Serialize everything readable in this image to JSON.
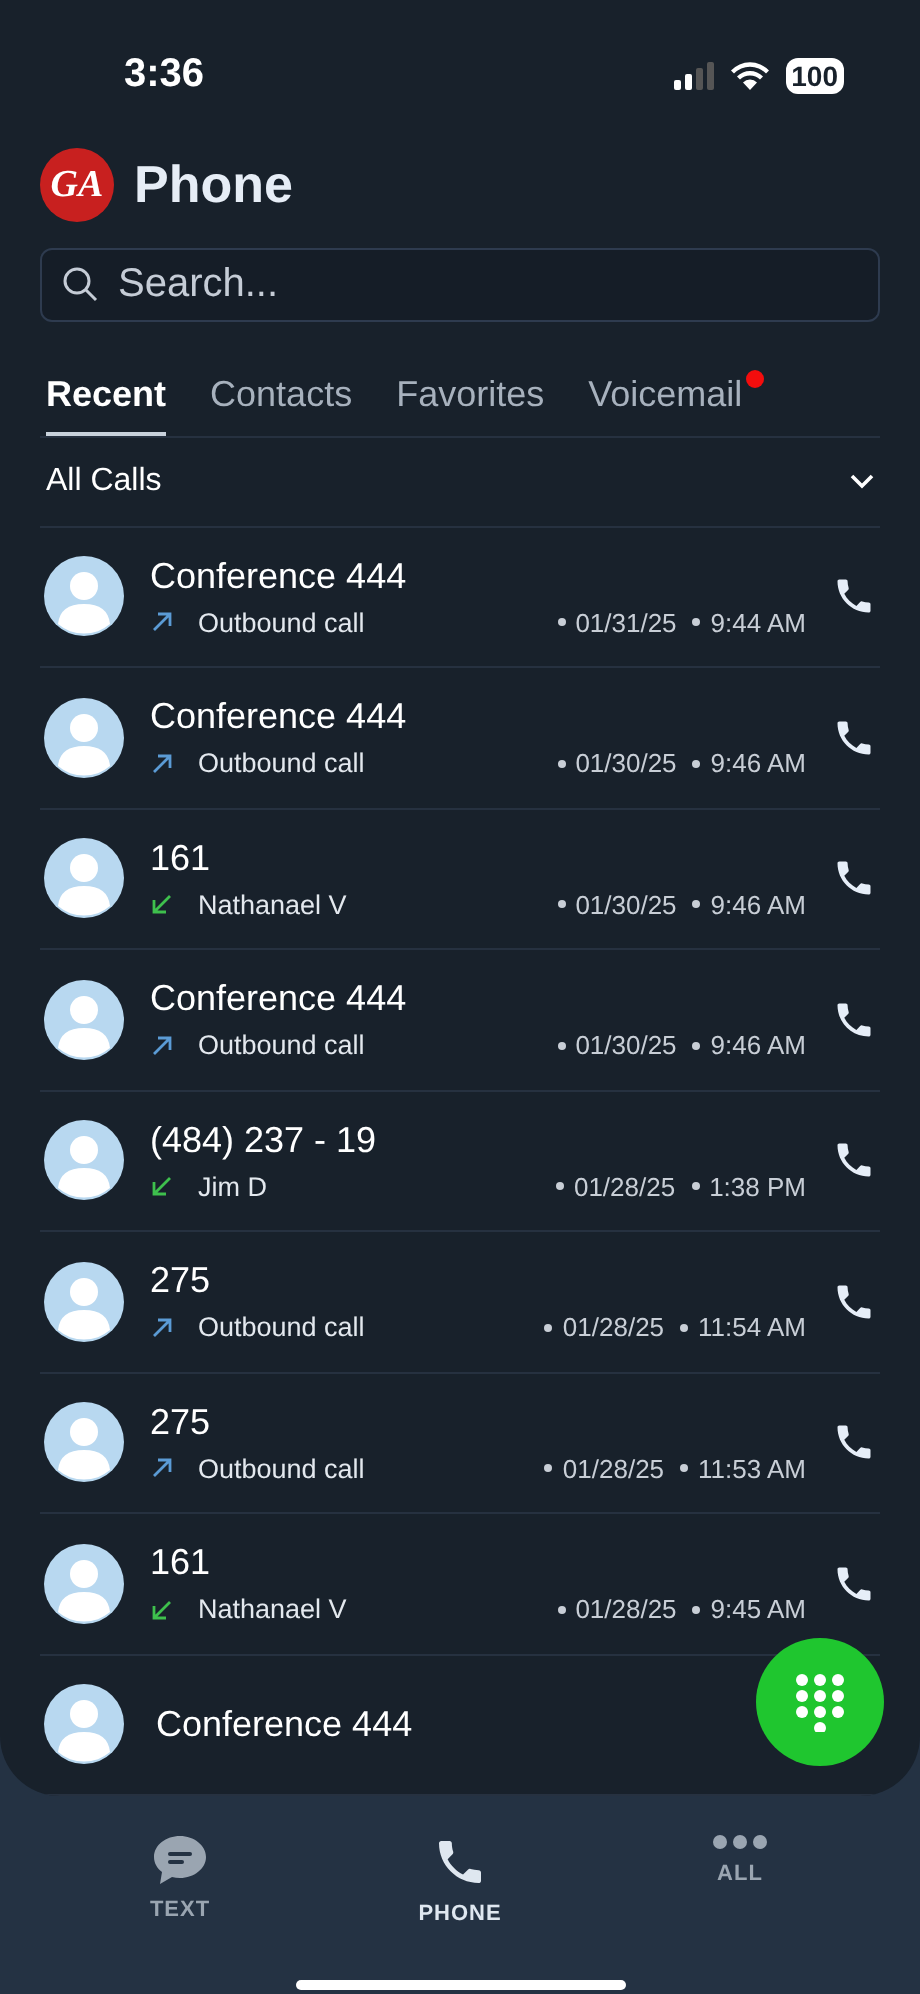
{
  "status_bar": {
    "time": "3:36",
    "battery": "100"
  },
  "header": {
    "logo": "GA",
    "title": "Phone"
  },
  "search": {
    "placeholder": "Search..."
  },
  "tabs": [
    {
      "label": "Recent",
      "selected": true,
      "badge": false
    },
    {
      "label": "Contacts",
      "selected": false,
      "badge": false
    },
    {
      "label": "Favorites",
      "selected": false,
      "badge": false
    },
    {
      "label": "Voicemail",
      "selected": false,
      "badge": true
    }
  ],
  "filter": {
    "label": "All Calls"
  },
  "calls": [
    {
      "name": "Conference 444",
      "kind": "outbound",
      "detail": "Outbound call",
      "date": "01/31/25",
      "time": "9:44 AM"
    },
    {
      "name": "Conference 444",
      "kind": "outbound",
      "detail": "Outbound call",
      "date": "01/30/25",
      "time": "9:46 AM"
    },
    {
      "name": "161",
      "kind": "inbound",
      "detail": "Nathanael V",
      "date": "01/30/25",
      "time": "9:46 AM"
    },
    {
      "name": "Conference 444",
      "kind": "outbound",
      "detail": "Outbound call",
      "date": "01/30/25",
      "time": "9:46 AM"
    },
    {
      "name": "(484) 237 - 19",
      "kind": "inbound",
      "detail": "Jim D",
      "date": "01/28/25",
      "time": "1:38 PM"
    },
    {
      "name": "275",
      "kind": "outbound",
      "detail": "Outbound call",
      "date": "01/28/25",
      "time": "11:54 AM"
    },
    {
      "name": "275",
      "kind": "outbound",
      "detail": "Outbound call",
      "date": "01/28/25",
      "time": "11:53 AM"
    },
    {
      "name": "161",
      "kind": "inbound",
      "detail": "Nathanael V",
      "date": "01/28/25",
      "time": "9:45 AM"
    },
    {
      "name": "Conference 444",
      "kind": "partial"
    }
  ],
  "nav": [
    {
      "label": "TEXT",
      "kind": "text",
      "selected": false
    },
    {
      "label": "PHONE",
      "kind": "phone",
      "selected": true
    },
    {
      "label": "ALL",
      "kind": "all",
      "selected": false
    }
  ]
}
